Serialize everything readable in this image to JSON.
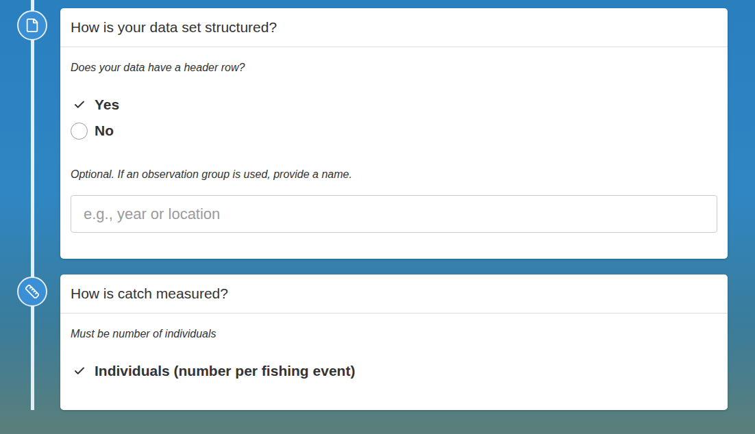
{
  "sections": [
    {
      "title": "How is your data set structured?",
      "fields": [
        {
          "kind": "choice",
          "prompt": "Does your data have a header row?",
          "options": [
            {
              "label": "Yes",
              "selected": true
            },
            {
              "label": "No",
              "selected": false
            }
          ]
        },
        {
          "kind": "text",
          "prompt": "Optional. If an observation group is used, provide a name.",
          "placeholder": "e.g., year or location",
          "value": ""
        }
      ]
    },
    {
      "title": "How is catch measured?",
      "fields": [
        {
          "kind": "choice",
          "prompt": "Must be number of individuals",
          "options": [
            {
              "label": "Individuals (number per fishing event)",
              "selected": true
            }
          ]
        }
      ]
    }
  ]
}
